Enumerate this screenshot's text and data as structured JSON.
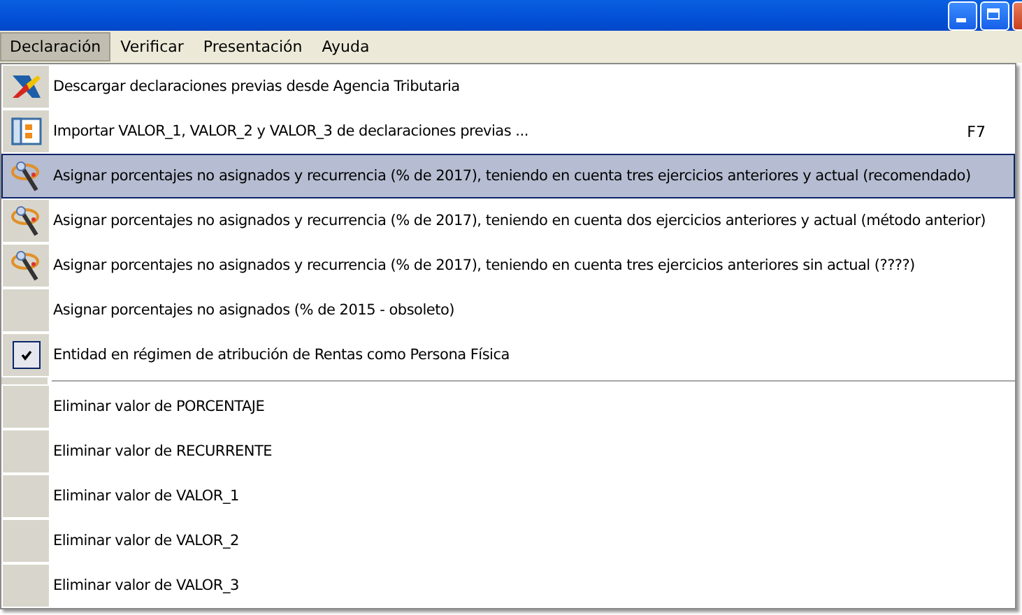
{
  "menubar": [
    {
      "label": "Declaración",
      "selected": true
    },
    {
      "label": "Verificar",
      "selected": false
    },
    {
      "label": "Presentación",
      "selected": false
    },
    {
      "label": "Ayuda",
      "selected": false
    }
  ],
  "menu": {
    "items": [
      {
        "kind": "logo",
        "label": "Descargar declaraciones previas desde Agencia Tributaria",
        "selected": false
      },
      {
        "kind": "table",
        "label": "Importar VALOR_1, VALOR_2 y VALOR_3 de declaraciones previas ...",
        "shortcut": "F7",
        "selected": false
      },
      {
        "kind": "wand",
        "label": "Asignar porcentajes no asignados y recurrencia (% de 2017), teniendo en cuenta tres ejercicios anteriores y actual (recomendado)",
        "selected": true
      },
      {
        "kind": "wand",
        "label": "Asignar porcentajes no asignados y recurrencia (% de 2017), teniendo en cuenta dos ejercicios anteriores y actual (método anterior)",
        "selected": false
      },
      {
        "kind": "wand",
        "label": "Asignar porcentajes no asignados y recurrencia (% de 2017), teniendo en cuenta tres ejercicios anteriores sin actual (????)",
        "selected": false
      },
      {
        "kind": "plain",
        "label": "Asignar porcentajes no asignados (% de 2015 - obsoleto)",
        "selected": false
      },
      {
        "kind": "check",
        "label": "Entidad en régimen de atribución de Rentas como Persona Física",
        "checked": true,
        "selected": false
      },
      {
        "kind": "separator"
      },
      {
        "kind": "plain",
        "label": "Eliminar valor de PORCENTAJE",
        "selected": false
      },
      {
        "kind": "plain",
        "label": "Eliminar valor de RECURRENTE",
        "selected": false
      },
      {
        "kind": "plain",
        "label": "Eliminar valor de VALOR_1",
        "selected": false
      },
      {
        "kind": "plain",
        "label": "Eliminar valor de VALOR_2",
        "selected": false
      },
      {
        "kind": "plain",
        "label": "Eliminar valor de VALOR_3",
        "selected": false
      }
    ]
  }
}
